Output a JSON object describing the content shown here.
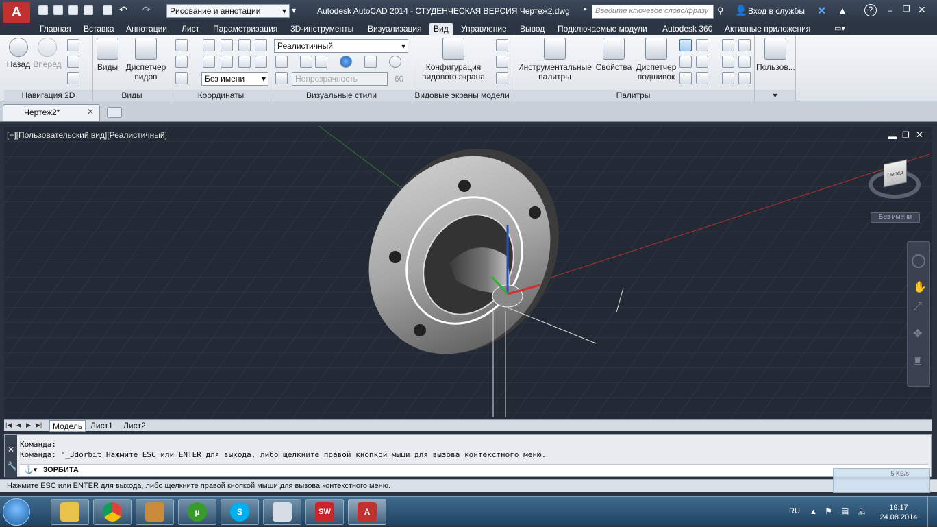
{
  "titlebar": {
    "workspace": "Рисование и аннотации",
    "app_title": "Autodesk AutoCAD 2014 - СТУДЕНЧЕСКАЯ ВЕРСИЯ    Чертеж2.dwg",
    "search_placeholder": "Введите ключевое слово/фразу",
    "signin": "Вход в службы"
  },
  "menu": {
    "tabs": [
      "Главная",
      "Вставка",
      "Аннотации",
      "Лист",
      "Параметризация",
      "3D-инструменты",
      "Визуализация",
      "Вид",
      "Управление",
      "Вывод",
      "Подключаемые модули",
      "Autodesk 360",
      "Активные приложения"
    ],
    "active": "Вид"
  },
  "ribbon": {
    "nav2d": {
      "title": "Навигация 2D",
      "back": "Назад",
      "forward": "Вперед"
    },
    "views": {
      "title": "Виды",
      "views_btn": "Виды",
      "view_manager": "Диспетчер видов"
    },
    "coords": {
      "title": "Координаты",
      "ucs_combo": "Без имени"
    },
    "visual_styles": {
      "title": "Визуальные стили",
      "style_combo": "Реалистичный",
      "opacity_label": "Непрозрачность",
      "opacity_value": "60"
    },
    "viewports": {
      "title": "Видовые экраны модели",
      "config": "Конфигурация видового экрана"
    },
    "palettes": {
      "title": "Палитры",
      "tool_palettes": "Инструментальные палитры",
      "properties": "Свойства",
      "sheet_manager": "Диспетчер подшивок"
    },
    "user": {
      "label": "Пользов..."
    }
  },
  "doc_tabs": {
    "current": "Чертеж2*"
  },
  "viewport": {
    "label": "[−][Пользовательский вид][Реалистичный]",
    "viewcube_face": "Перед",
    "named_view": "Без имени"
  },
  "layout_tabs": [
    "Модель",
    "Лист1",
    "Лист2"
  ],
  "command_line": {
    "history": [
      "Команда:",
      "Команда: '_3dorbit Нажмите ESC или ENTER для выхода, либо щелкните правой кнопкой мыши для вызова контекстного меню."
    ],
    "current": "3ОРБИТА"
  },
  "status": {
    "message": "Нажмите ESC или ENTER для выхода, либо щелкните правой кнопкой мыши для вызова контекстного меню.",
    "net_speed": "5 KB/s"
  },
  "taskbar": {
    "lang": "RU",
    "time": "19:17",
    "date": "24.08.2014"
  }
}
